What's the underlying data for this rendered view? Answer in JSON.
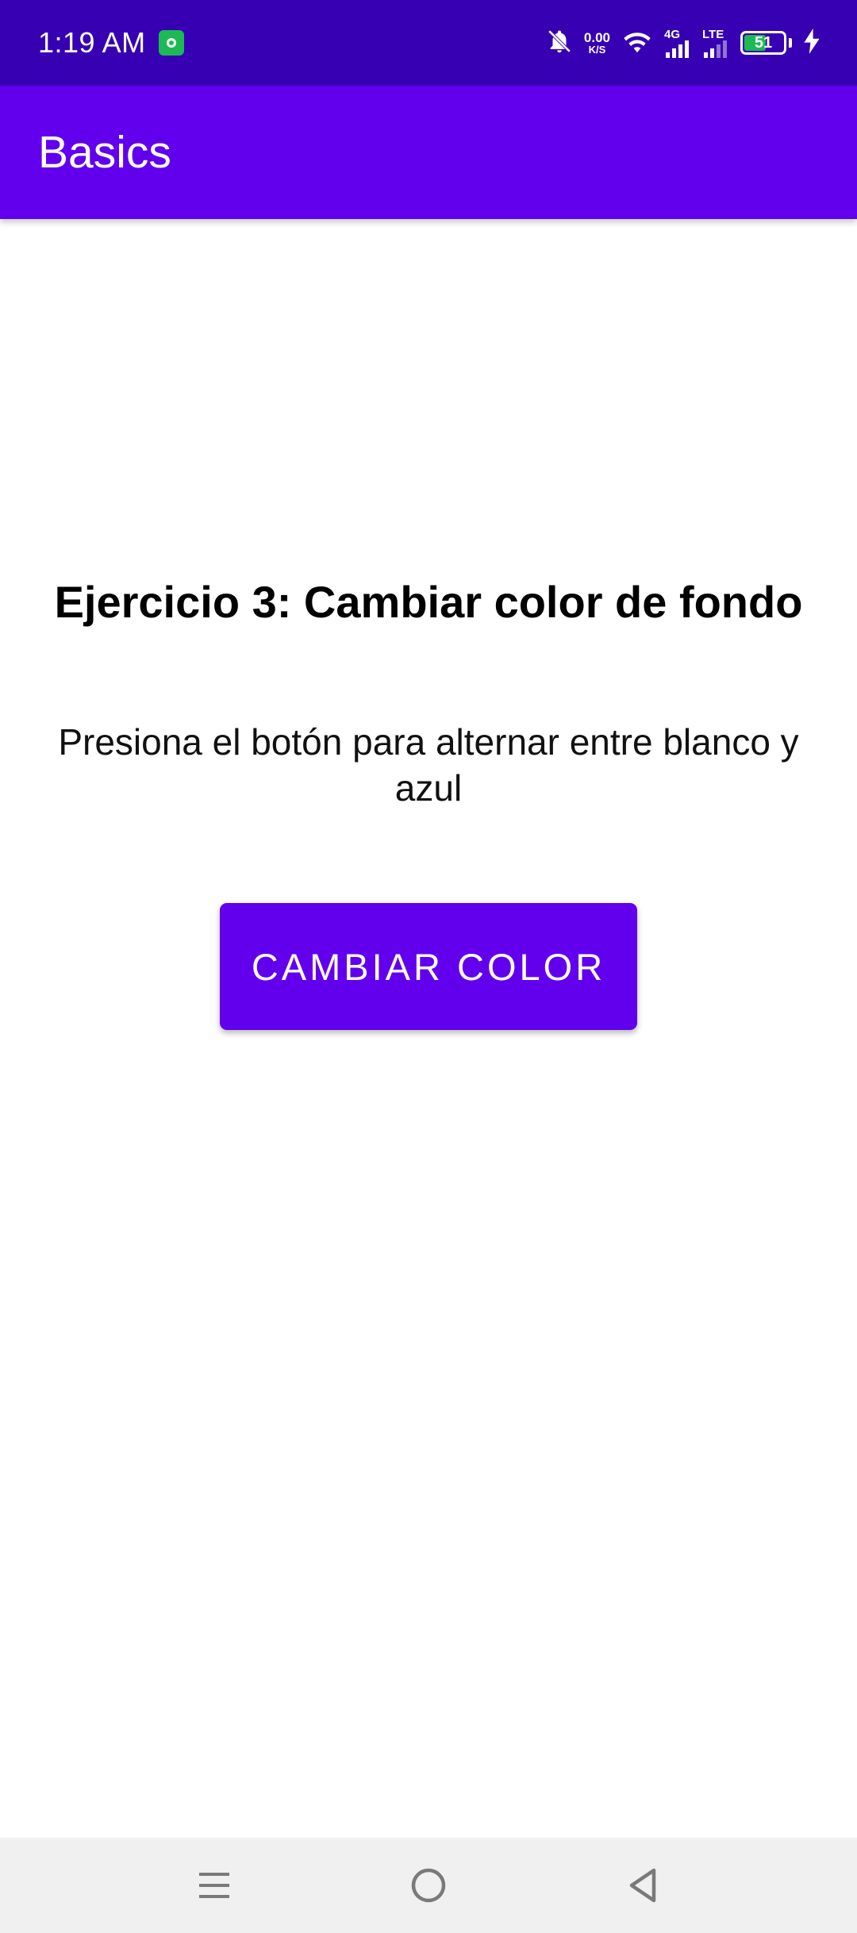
{
  "status_bar": {
    "time": "1:19 AM",
    "net_speed_value": "0.00",
    "net_speed_unit": "K/S",
    "network_4g": "4G",
    "network_lte": "LTE",
    "battery_level": "51"
  },
  "app_bar": {
    "title": "Basics"
  },
  "main": {
    "heading": "Ejercicio 3: Cambiar color de fondo",
    "description": "Presiona el botón para alternar entre blanco y azul",
    "button_label": "CAMBIAR COLOR"
  },
  "colors": {
    "status_bar": "#3700b3",
    "primary": "#6200ee",
    "background": "#ffffff",
    "nav_bar": "#f0f0f0"
  },
  "icons": {
    "notification_app": "app-notification-icon",
    "mute": "bell-off-icon",
    "wifi": "wifi-icon",
    "signal": "signal-icon",
    "charging": "charging-bolt-icon",
    "nav_recents": "menu-icon",
    "nav_home": "home-circle-icon",
    "nav_back": "back-triangle-icon"
  }
}
